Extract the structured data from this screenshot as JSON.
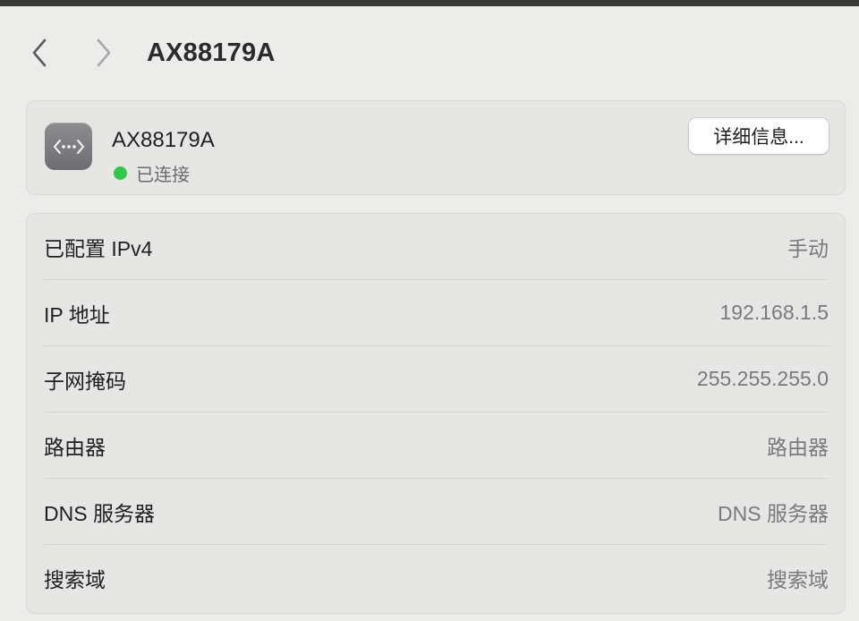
{
  "header": {
    "title": "AX88179A",
    "back_icon": "chevron-left-icon",
    "forward_icon": "chevron-right-icon"
  },
  "device": {
    "name": "AX88179A",
    "icon": "ethernet-icon",
    "status": "已连接",
    "status_color": "#34c84a",
    "details_button": "详细信息..."
  },
  "settings": {
    "rows": [
      {
        "label": "已配置 IPv4",
        "value": "手动"
      },
      {
        "label": "IP 地址",
        "value": "192.168.1.5"
      },
      {
        "label": "子网掩码",
        "value": "255.255.255.0"
      },
      {
        "label": "路由器",
        "value": "路由器"
      },
      {
        "label": "DNS 服务器",
        "value": "DNS 服务器"
      },
      {
        "label": "搜索域",
        "value": "搜索域"
      }
    ]
  }
}
